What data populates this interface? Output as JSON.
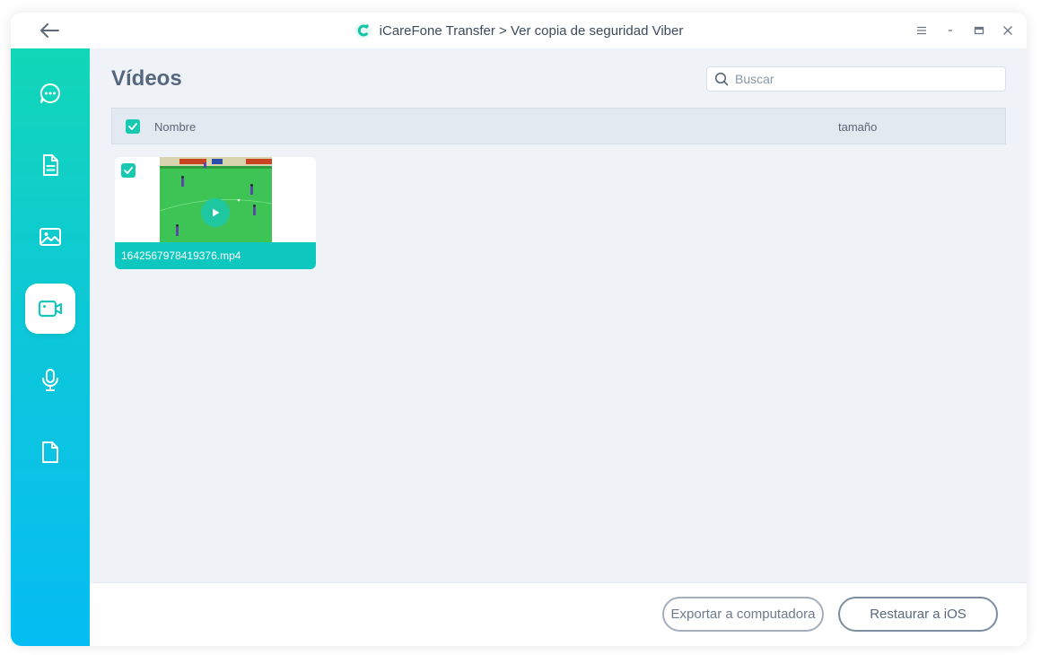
{
  "window": {
    "title": "iCareFone Transfer > Ver copia de seguridad Viber"
  },
  "titlebar_icons": {
    "back": "arrow-left-icon",
    "menu": "hamburger-menu-icon",
    "minimize": "minimize-icon",
    "maximize": "maximize-icon",
    "close": "close-icon"
  },
  "sidebar": {
    "items": [
      {
        "name": "messages",
        "icon": "chat-bubble-icon",
        "active": false
      },
      {
        "name": "documents",
        "icon": "document-icon",
        "active": false
      },
      {
        "name": "photos",
        "icon": "image-icon",
        "active": false
      },
      {
        "name": "videos",
        "icon": "video-camera-icon",
        "active": true
      },
      {
        "name": "audio",
        "icon": "microphone-icon",
        "active": false
      },
      {
        "name": "files",
        "icon": "file-icon",
        "active": false
      }
    ]
  },
  "main": {
    "title": "Vídeos",
    "search": {
      "placeholder": "Buscar",
      "value": ""
    },
    "columns": {
      "name": "Nombre",
      "size": "tamaño"
    },
    "select_all_checked": true,
    "videos": [
      {
        "filename": "1642567978419376.mp4",
        "checked": true
      }
    ]
  },
  "footer": {
    "export_label": "Exportar a computadora",
    "restore_label": "Restaurar a iOS"
  },
  "colors": {
    "accent": "#17c9b0",
    "sidebar_top": "#12d7b7",
    "sidebar_bottom": "#06bdf3",
    "main_bg": "#eff3f8",
    "title_text": "#56677d"
  }
}
